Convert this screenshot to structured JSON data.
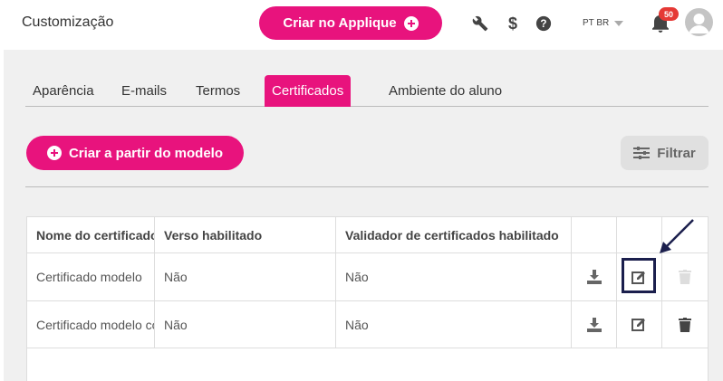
{
  "header": {
    "title": "Customização",
    "create_label": "Criar no Applique",
    "language": "PT BR",
    "notification_count": "50",
    "icons": [
      "wrench-icon",
      "dollar-icon",
      "help-icon",
      "bell-icon",
      "avatar-icon"
    ]
  },
  "tabs": [
    {
      "label": "Aparência",
      "active": false
    },
    {
      "label": "E-mails",
      "active": false
    },
    {
      "label": "Termos",
      "active": false
    },
    {
      "label": "Certificados",
      "active": true
    },
    {
      "label": "Ambiente do aluno",
      "active": false
    }
  ],
  "actions": {
    "create_from_model_label": "Criar a partir do modelo",
    "filter_label": "Filtrar"
  },
  "table": {
    "columns": [
      "Nome do certificado",
      "Verso habilitado",
      "Validador de certificados habilitado",
      "",
      "",
      ""
    ],
    "rows": [
      {
        "name": "Certificado modelo",
        "back_enabled": "Não",
        "validator_enabled": "Não",
        "delete_enabled": false
      },
      {
        "name": "Certificado modelo cópia",
        "back_enabled": "Não",
        "validator_enabled": "Não",
        "delete_enabled": true
      }
    ]
  },
  "colors": {
    "accent": "#e8137d",
    "background": "#f0f0f0",
    "badge": "#e53935",
    "highlight": "#1b1f4d"
  }
}
